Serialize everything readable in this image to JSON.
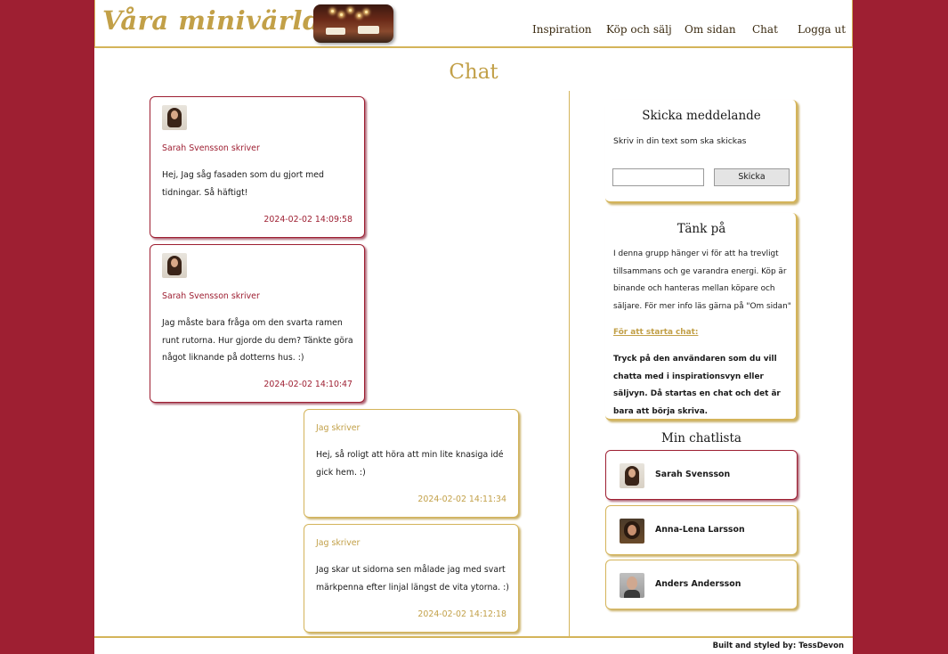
{
  "header": {
    "logo": "Våra minivärldar",
    "nav": [
      "Inspiration",
      "Köp och sälj",
      "Om sidan",
      "Chat",
      "Logga ut"
    ]
  },
  "page_title": "Chat",
  "messages": [
    {
      "writer": "Sarah Svensson skriver",
      "text": "Hej, Jag såg fasaden som du gjort med tidningar. Så häftigt!",
      "time": "2024-02-02 14:09:58"
    },
    {
      "writer": "Sarah Svensson skriver",
      "text": "Jag måste bara fråga om den svarta ramen runt rutorna. Hur gjorde du dem? Tänkte göra något liknande på dotterns hus. :)",
      "time": "2024-02-02 14:10:47"
    },
    {
      "writer": "Jag skriver",
      "text": "Hej, så roligt att höra att min lite knasiga idé gick hem. :)",
      "time": "2024-02-02 14:11:34"
    },
    {
      "writer": "Jag skriver",
      "text": "Jag skar ut sidorna sen målade jag med svart märkpenna efter linjal längst de vita ytorna. :)",
      "time": "2024-02-02 14:12:18"
    }
  ],
  "send": {
    "title": "Skicka meddelande",
    "instruction": "Skriv in din text som ska skickas",
    "input_value": "",
    "button": "Skicka"
  },
  "think": {
    "title": "Tänk på",
    "text": "I denna grupp hänger vi för att ha trevligt tillsammans och ge varandra energi. Köp är binande och hanteras mellan köpare och säljare. För mer info läs gärna på \"Om sidan\"",
    "start_heading": "För att starta chat:",
    "start_text": "Tryck på den användaren som du vill chatta med i inspirationsvyn eller säljvyn. Då startas en chat och det är bara att börja skriva."
  },
  "chatlist": {
    "title": "Min chatlista",
    "items": [
      {
        "name": "Sarah Svensson",
        "avatar": "sarah-avatar"
      },
      {
        "name": "Anna-Lena Larsson",
        "avatar": "anna-lena-avatar"
      },
      {
        "name": "Anders Andersson",
        "avatar": "anders-avatar"
      }
    ]
  },
  "footer": "Built and styled by: TessDevon",
  "colors": {
    "background": "#9e1f32",
    "accent": "#c2a048",
    "other_message_border": "#9e1f32",
    "my_message_border": "#d4b45a"
  }
}
